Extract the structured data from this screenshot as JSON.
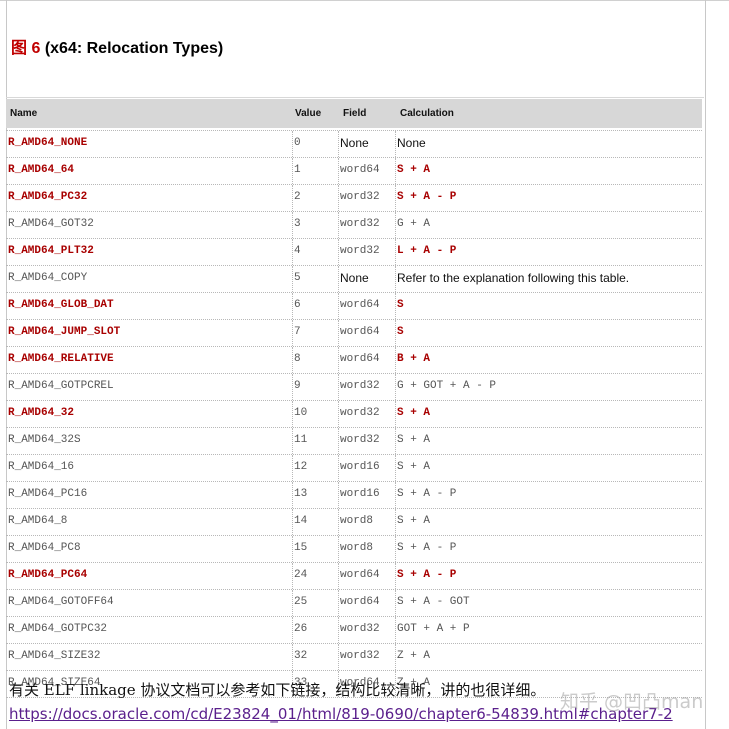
{
  "figure": {
    "label": "图 6",
    "title": "(x64: Relocation Types)"
  },
  "table": {
    "headers": {
      "name": "Name",
      "value": "Value",
      "field": "Field",
      "calculation": "Calculation"
    },
    "rows": [
      {
        "name": "R_AMD64_NONE",
        "value": "0",
        "field": "None",
        "calc": "None",
        "bold": true,
        "field_sans": true,
        "calc_sans": true
      },
      {
        "name": "R_AMD64_64",
        "value": "1",
        "field": "word64",
        "calc": "S + A",
        "bold": true
      },
      {
        "name": "R_AMD64_PC32",
        "value": "2",
        "field": "word32",
        "calc": "S + A - P",
        "bold": true
      },
      {
        "name": "R_AMD64_GOT32",
        "value": "3",
        "field": "word32",
        "calc": "G + A",
        "bold": false
      },
      {
        "name": "R_AMD64_PLT32",
        "value": "4",
        "field": "word32",
        "calc": "L + A - P",
        "bold": true
      },
      {
        "name": "R_AMD64_COPY",
        "value": "5",
        "field": "None",
        "calc": "Refer to the explanation following this table.",
        "bold": false,
        "field_sans": true,
        "calc_sans": true
      },
      {
        "name": "R_AMD64_GLOB_DAT",
        "value": "6",
        "field": "word64",
        "calc": "S",
        "bold": true
      },
      {
        "name": "R_AMD64_JUMP_SLOT",
        "value": "7",
        "field": "word64",
        "calc": "S",
        "bold": true
      },
      {
        "name": "R_AMD64_RELATIVE",
        "value": "8",
        "field": "word64",
        "calc": "B + A",
        "bold": true
      },
      {
        "name": "R_AMD64_GOTPCREL",
        "value": "9",
        "field": "word32",
        "calc": "G + GOT + A - P",
        "bold": false
      },
      {
        "name": "R_AMD64_32",
        "value": "10",
        "field": "word32",
        "calc": "S + A",
        "bold": true
      },
      {
        "name": "R_AMD64_32S",
        "value": "11",
        "field": "word32",
        "calc": "S + A",
        "bold": false
      },
      {
        "name": "R_AMD64_16",
        "value": "12",
        "field": "word16",
        "calc": "S + A",
        "bold": false
      },
      {
        "name": "R_AMD64_PC16",
        "value": "13",
        "field": "word16",
        "calc": "S + A - P",
        "bold": false
      },
      {
        "name": "R_AMD64_8",
        "value": "14",
        "field": "word8",
        "calc": "S + A",
        "bold": false
      },
      {
        "name": "R_AMD64_PC8",
        "value": "15",
        "field": "word8",
        "calc": "S + A - P",
        "bold": false
      },
      {
        "name": "R_AMD64_PC64",
        "value": "24",
        "field": "word64",
        "calc": "S + A - P",
        "bold": true
      },
      {
        "name": "R_AMD64_GOTOFF64",
        "value": "25",
        "field": "word64",
        "calc": "S + A - GOT",
        "bold": false
      },
      {
        "name": "R_AMD64_GOTPC32",
        "value": "26",
        "field": "word32",
        "calc": "GOT + A + P",
        "bold": false
      },
      {
        "name": "R_AMD64_SIZE32",
        "value": "32",
        "field": "word32",
        "calc": "Z + A",
        "bold": false
      },
      {
        "name": "R_AMD64_SIZE64",
        "value": "33",
        "field": "word64",
        "calc": "Z + A",
        "bold": false
      }
    ]
  },
  "note": "有关 ELF linkage 协议文档可以参考如下链接，结构比较清晰，讲的也很详细。",
  "link": "https://docs.oracle.com/cd/E23824_01/html/819-0690/chapter6-54839.html#chapter7-2",
  "watermark": "知乎 @凹凸man",
  "colors": {
    "accent": "#a80000",
    "header_bg": "#d7d7d7",
    "link": "#5a1f8c"
  }
}
